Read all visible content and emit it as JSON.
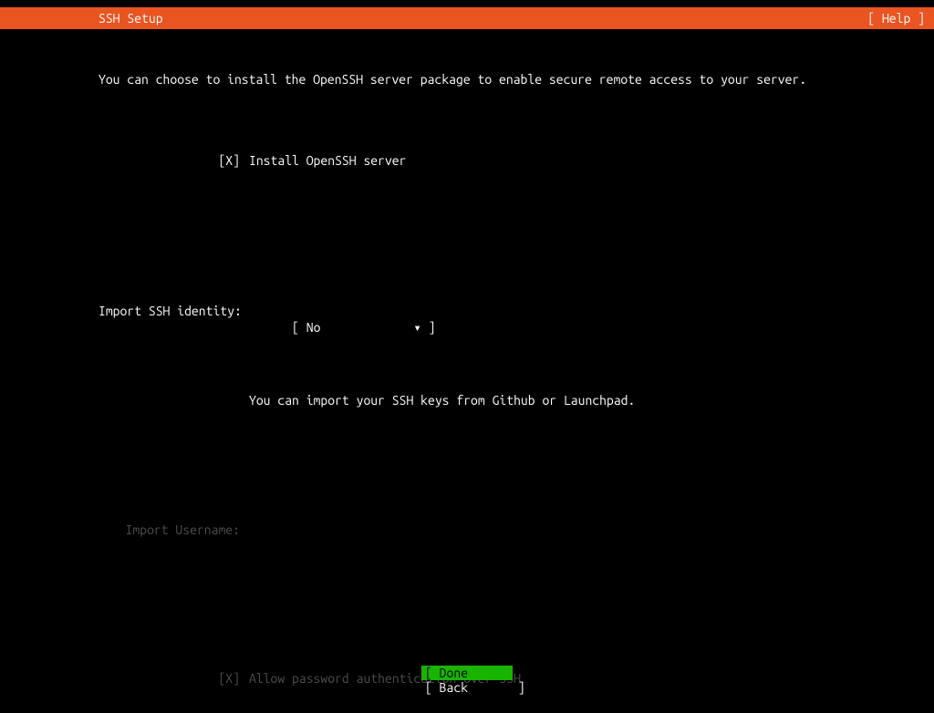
{
  "titlebar": {
    "title": "SSH Setup",
    "help": "[ Help ]"
  },
  "description": "You can choose to install the OpenSSH server package to enable secure remote access to your server.",
  "install_openssh": {
    "mark": "[X]",
    "label": "Install OpenSSH server"
  },
  "import_identity": {
    "label": "Import SSH identity:",
    "dropdown": "[ No             ▾ ]",
    "hint": "You can import your SSH keys from Github or Launchpad."
  },
  "import_username": {
    "label": "Import Username:",
    "value": ""
  },
  "allow_password": {
    "mark": "[X]",
    "label": "Allow password authentication over SSH"
  },
  "buttons": {
    "done": "[ Done       ]",
    "back": "[ Back       ]"
  }
}
